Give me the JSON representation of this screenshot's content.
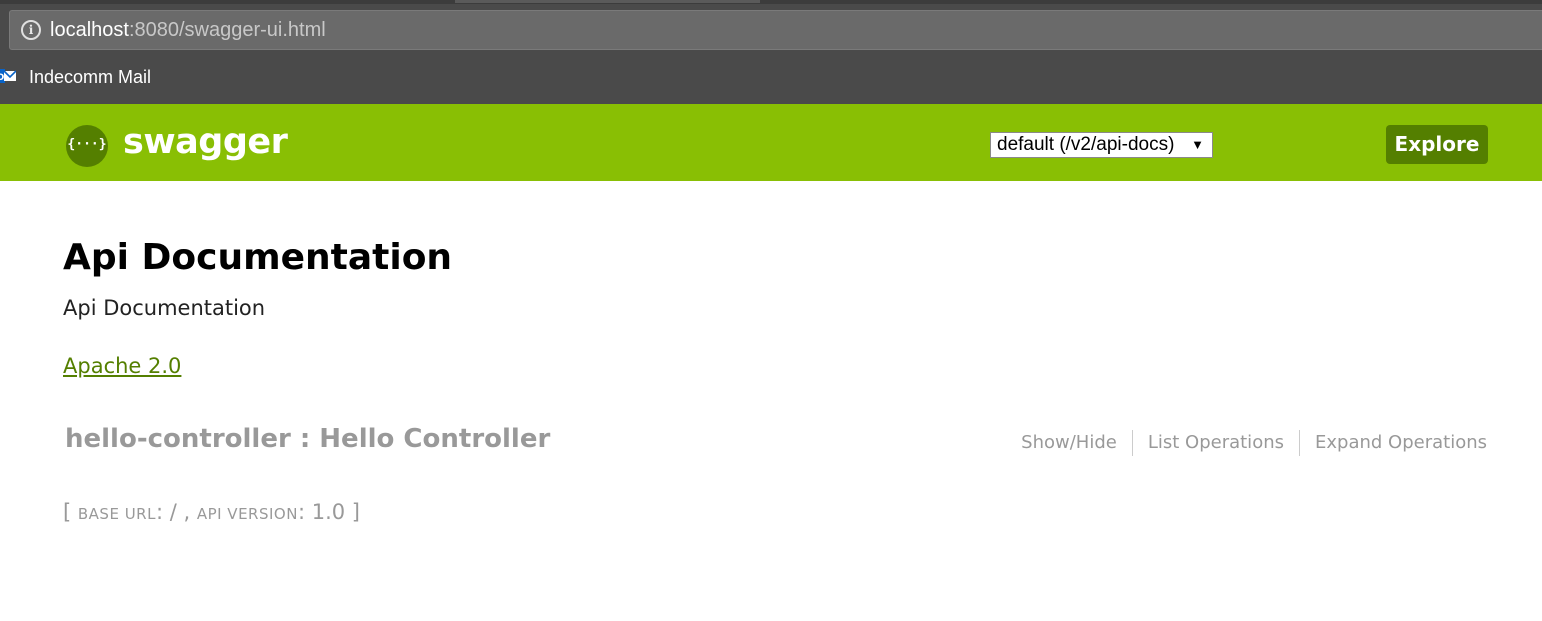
{
  "browser": {
    "url_host": "localhost",
    "url_rest": ":8080/swagger-ui.html",
    "bookmarks": [
      {
        "label": "Indecomm Mail",
        "icon": "mail-icon"
      }
    ]
  },
  "header": {
    "brand": "swagger",
    "logo_glyph": "{···}",
    "spec_select": {
      "selected": "default (/v2/api-docs)",
      "arrow": "▼"
    },
    "explore_label": "Explore",
    "colors": {
      "background": "#89bf04",
      "dark": "#547f00"
    }
  },
  "info": {
    "title": "Api Documentation",
    "description": "Api Documentation",
    "license": "Apache 2.0"
  },
  "resource": {
    "heading": "hello-controller : Hello Controller",
    "ops": [
      "Show/Hide",
      "List Operations",
      "Expand Operations"
    ]
  },
  "footer": {
    "open": "[ ",
    "base_url_label": "base url",
    "base_url_value": ": / , ",
    "api_version_label": "api version",
    "api_version_value": ": 1.0 ]"
  }
}
